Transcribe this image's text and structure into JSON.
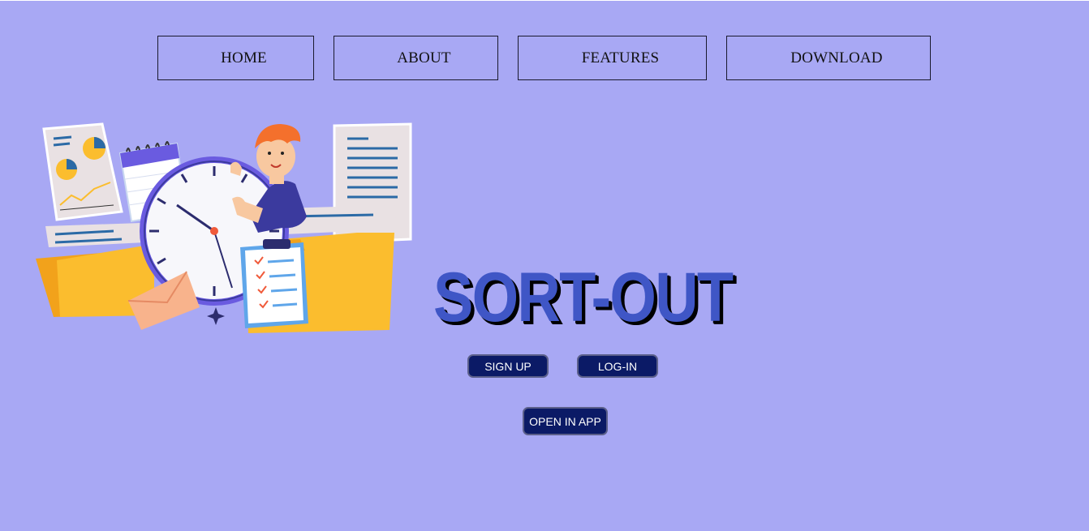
{
  "nav": {
    "items": [
      {
        "label": "HOME"
      },
      {
        "label": "ABOUT"
      },
      {
        "label": "FEATURES"
      },
      {
        "label": "DOWNLOAD"
      }
    ]
  },
  "hero": {
    "brand_title": "SORT-OUT",
    "illustration_icon": "time-management-illustration",
    "buttons": {
      "signup_label": "SIGN UP",
      "login_label": "LOG-IN",
      "open_app_label": "OPEN IN APP"
    }
  },
  "colors": {
    "background": "#a8a8f4",
    "brand_text": "#3f56c6",
    "button_bg": "#0b1a66",
    "folder": "#fbbd2e",
    "clock_accent": "#6a5be0"
  }
}
